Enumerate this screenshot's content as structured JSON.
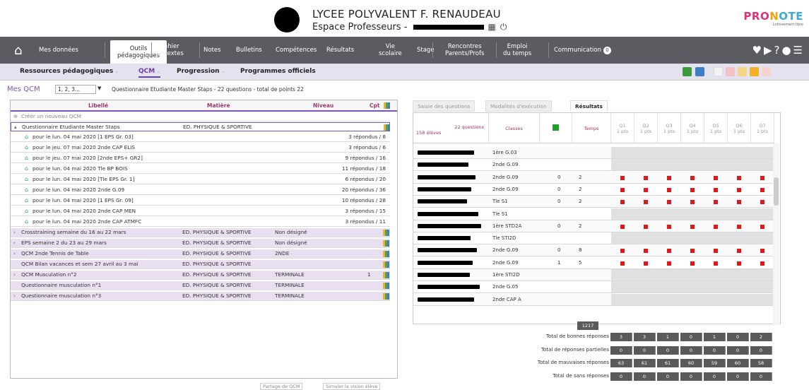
{
  "header": {
    "school": "LYCEE POLYVALENT F. RENAUDEAU",
    "space": "Espace Professeurs - ",
    "brand_a": "PRO",
    "brand_b": "N",
    "brand_c": "OTE",
    "brand_sub": "Lotissement libre"
  },
  "nav": {
    "items": [
      "Mes données",
      "Outils\npédagogiques",
      "Cahier\nde textes",
      "Notes",
      "Bulletins",
      "Compétences",
      "Résultats",
      "Vie\nscolaire",
      "Stage",
      "Rencontres\nParents/Profs",
      "Emploi\ndu temps",
      "Communication"
    ],
    "comm_badge": "0",
    "right_icons": "♥▶?●☰"
  },
  "subnav": {
    "items": [
      "Ressources pédagogiques",
      "QCM",
      "Progression",
      "Programmes officiels"
    ]
  },
  "qcm_bar": {
    "label": "Mes QCM",
    "select": "1, 2, 3...",
    "description": "Questionnaire Etudiante Master Staps - 22 questions - total de points 22"
  },
  "left": {
    "headers": [
      "Libellé",
      "Matière",
      "Niveau",
      "Cpt"
    ],
    "create": "Créer un nouveau QCM",
    "rows": [
      {
        "kind": "parent",
        "label": "Questionnaire Etudiante Master Staps",
        "matiere": "ED. PHYSIQUE & SPORTIVE",
        "niveau": "",
        "cpt": ""
      },
      {
        "kind": "child",
        "label": "pour le lun. 04 mai 2020 [1 EPS Gr. 03]",
        "rep": "3 répondus / 8"
      },
      {
        "kind": "child",
        "label": "pour le jeu. 07 mai 2020 2nde CAP ELIS",
        "rep": "3 répondus / 6"
      },
      {
        "kind": "child",
        "label": "pour le jeu. 07 mai 2020 [2nde EPS+ GR2]",
        "rep": "9 répondus / 16"
      },
      {
        "kind": "child",
        "label": "pour le lun. 04 mai 2020 Tle BP BOIS",
        "rep": "11 répondus / 18"
      },
      {
        "kind": "child",
        "label": "pour le lun. 04 mai 2020 [Tle EPS Gr. 1]",
        "rep": "6 répondus / 20"
      },
      {
        "kind": "child",
        "label": "pour le lun. 04 mai 2020 2nde G.09",
        "rep": "20 répondus / 36"
      },
      {
        "kind": "child",
        "label": "pour le lun. 04 mai 2020 [1 EPS Gr. 09]",
        "rep": "10 répondus / 28"
      },
      {
        "kind": "child",
        "label": "pour le lun. 04 mai 2020 2nde CAP MEN",
        "rep": "3 répondus / 15"
      },
      {
        "kind": "child",
        "label": "pour le lun. 04 mai 2020 2nde CAP ATMFC",
        "rep": "3 répondus / 11"
      },
      {
        "kind": "parent",
        "label": "Crosstraining semaine du 16 au 22 mars",
        "matiere": "ED. PHYSIQUE & SPORTIVE",
        "niveau": "Non désigné",
        "cpt": ""
      },
      {
        "kind": "parent",
        "label": "EPS semaine 2 du 23 au 29 mars",
        "matiere": "ED. PHYSIQUE & SPORTIVE",
        "niveau": "Non désigné",
        "cpt": ""
      },
      {
        "kind": "parent",
        "label": "QCM 2nde Tennis de Table",
        "matiere": "ED. PHYSIQUE & SPORTIVE",
        "niveau": "2NDE",
        "cpt": ""
      },
      {
        "kind": "flat",
        "label": "QCM Bilan vacances et sem 27 avril au 3 mai",
        "matiere": "ED. PHYSIQUE & SPORTIVE",
        "niveau": "",
        "cpt": ""
      },
      {
        "kind": "parent",
        "label": "QCM Musculation n°2",
        "matiere": "ED. PHYSIQUE & SPORTIVE",
        "niveau": "TERMINALE",
        "cpt": "1"
      },
      {
        "kind": "flat",
        "label": "Questionnaire musculation n°1",
        "matiere": "ED. PHYSIQUE & SPORTIVE",
        "niveau": "TERMINALE",
        "cpt": ""
      },
      {
        "kind": "parent",
        "label": "Questionnaire musculation n°3",
        "matiere": "ED. PHYSIQUE & SPORTIVE",
        "niveau": "TERMINALE",
        "cpt": ""
      }
    ],
    "buttons": [
      "Partage de QCM",
      "Simuler la vision élève"
    ]
  },
  "right": {
    "tabs": [
      "Saisie des questions",
      "Modalités d'exécution",
      "Résultats"
    ],
    "head_questions": "22 questions",
    "head_students": "158 élèves",
    "head_classes": "Classes",
    "head_time": "Temps",
    "qcols": [
      {
        "q": "Q1",
        "p": "1 pts"
      },
      {
        "q": "Q2",
        "p": "1 pts"
      },
      {
        "q": "Q3",
        "p": "1 pts"
      },
      {
        "q": "Q4",
        "p": "1 pts"
      },
      {
        "q": "Q5",
        "p": "1 pts"
      },
      {
        "q": "Q6",
        "p": "1 pts"
      },
      {
        "q": "Q7",
        "p": "1 pts"
      }
    ],
    "rows": [
      {
        "classe": "1ère G.03",
        "a": "",
        "t": "",
        "marks": false
      },
      {
        "classe": "2nde G.09",
        "a": "",
        "t": "",
        "marks": false
      },
      {
        "classe": "2nde G.09",
        "a": "0",
        "t": "2",
        "marks": true
      },
      {
        "classe": "2nde G.09",
        "a": "0",
        "t": "2",
        "marks": true
      },
      {
        "classe": "Tle S1",
        "a": "0",
        "t": "2",
        "marks": true
      },
      {
        "classe": "Tle S1",
        "a": "",
        "t": "",
        "marks": false
      },
      {
        "classe": "1ère STD2A",
        "a": "0",
        "t": "2",
        "marks": true
      },
      {
        "classe": "Tle STI2D",
        "a": "",
        "t": "",
        "marks": false
      },
      {
        "classe": "2nde G.09",
        "a": "0",
        "t": "8",
        "marks": true
      },
      {
        "classe": "2nde G.09",
        "a": "1",
        "t": "5",
        "marks": true
      },
      {
        "classe": "1ère STI2D",
        "a": "",
        "t": "",
        "marks": false
      },
      {
        "classe": "2nde G.05",
        "a": "",
        "t": "",
        "marks": false
      },
      {
        "classe": "2nde CAP A",
        "a": "",
        "t": "",
        "marks": false
      }
    ],
    "time_total": "1217 min",
    "totals": [
      {
        "label": "Total de bonnes réponses",
        "values": [
          "3",
          "3",
          "1",
          "0",
          "1",
          "0",
          "2"
        ]
      },
      {
        "label": "Total de réponses partielles",
        "values": [
          "0",
          "0",
          "0",
          "0",
          "0",
          "0",
          "0"
        ]
      },
      {
        "label": "Total de mauvaises réponses",
        "values": [
          "63",
          "61",
          "61",
          "60",
          "59",
          "60",
          "58"
        ]
      },
      {
        "label": "Total de sans réponses",
        "values": [
          "0",
          "0",
          "0",
          "0",
          "0",
          "0",
          "0"
        ]
      }
    ]
  }
}
